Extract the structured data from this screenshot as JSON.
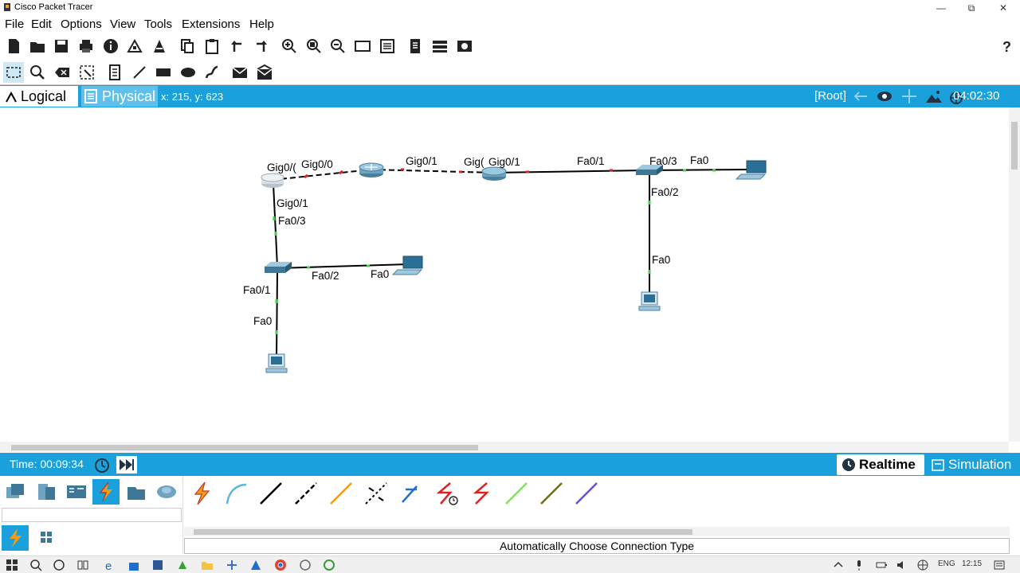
{
  "window": {
    "title": "Cisco Packet Tracer"
  },
  "menu": [
    "File",
    "Edit",
    "Options",
    "View",
    "Tools",
    "Extensions",
    "Help"
  ],
  "workspace": {
    "tab_logical": "Logical",
    "tab_physical": "Physical",
    "coords": "x: 215, y: 623",
    "root": "[Root]",
    "clock": "04:02:30"
  },
  "topology": {
    "port_labels": [
      "Gig0/(",
      "Gig0/0",
      "Gig0/1",
      "Gig(",
      "Gig0/1",
      "Fa0/1",
      "Fa0/3",
      "Fa0",
      "Fa0/2",
      "Fa0",
      "Gig0/1",
      "Fa0/3",
      "Fa0/2",
      "Fa0",
      "Fa0/1",
      "Fa0"
    ]
  },
  "simulation_bar": {
    "time": "Time: 00:09:34",
    "realtime": "Realtime",
    "simulation": "Simulation"
  },
  "bottom": {
    "connection_type": "Automatically Choose Connection Type"
  },
  "tray": {
    "lang": "ENG",
    "time": "12:15"
  },
  "colors": {
    "accent": "#1aa1dc",
    "link_up": "#44cc44",
    "link_down": "#dd2222"
  }
}
